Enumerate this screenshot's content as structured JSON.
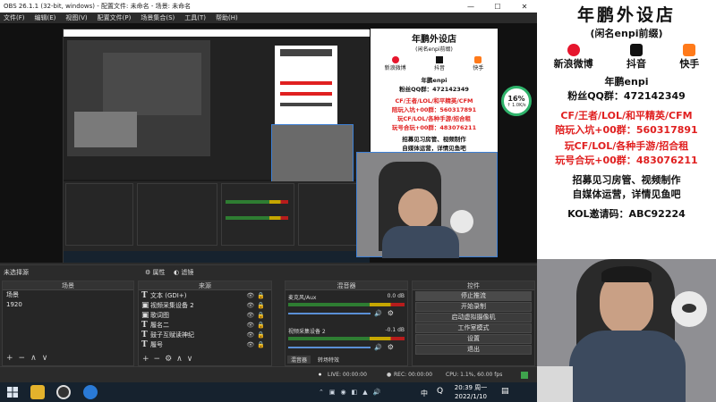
{
  "window": {
    "title": "OBS 26.1.1 (32-bit, windows) - 配置文件: 未命名 - 场景: 未命名"
  },
  "menu": [
    "文件(F)",
    "编辑(E)",
    "视图(V)",
    "配置文件(P)",
    "场景集合(S)",
    "工具(T)",
    "帮助(H)"
  ],
  "preview": {
    "shop_title": "年鹏外设店",
    "shop_subtitle": "(闲名enpi前缀)",
    "socials": [
      {
        "icon": "weibo-icon",
        "label": "新浪微博",
        "color": "#e6162d"
      },
      {
        "icon": "douyin-icon",
        "label": "抖音",
        "color": "#111111"
      },
      {
        "icon": "kuaishou-icon",
        "label": "快手",
        "color": "#ff7a1a"
      }
    ],
    "progress_badge": "16%",
    "progress_sub": "↑ 1.0K/s"
  },
  "filter_bar": {
    "label": "未选择源",
    "props_label": "属性",
    "filters_label": "滤镜"
  },
  "docks": {
    "scenes": {
      "title": "场景",
      "items": [
        "场景",
        "1920"
      ]
    },
    "sources": {
      "title": "来源",
      "items": [
        "文本 (GDI+)",
        "视频采集设备 2",
        "歌词图",
        "履名二",
        "鼓子互赋读神纪",
        "履号"
      ]
    },
    "mixer": {
      "title": "混音器",
      "channels": [
        {
          "name": "麦克风/Aux",
          "db": "0.0 dB"
        },
        {
          "name": "视频采集设备 2",
          "db": "-0.1 dB"
        }
      ],
      "tabs": [
        "混音器",
        "转场特效"
      ]
    },
    "controls": {
      "title": "控件",
      "buttons": [
        "停止推流",
        "开始录制",
        "启动虚拟摄像机",
        "工作室模式",
        "设置",
        "退出"
      ]
    }
  },
  "status": {
    "live": "LIVE: 00:00:00",
    "rec": "REC: 00:00:00",
    "cpu": "CPU: 1.1%, 60.00 fps"
  },
  "taskbar": {
    "time": "20:39 周一",
    "date": "2022/1/10",
    "ime": "中"
  },
  "promo": {
    "title": "年鹏外设店",
    "subtitle": "(闲名enpi前缀)",
    "socials": [
      "新浪微博",
      "抖音",
      "快手"
    ],
    "brand": "年鹏enpi",
    "qq_group": "粉丝QQ群：472142349",
    "line1": "CF/王者/LOL/和平精英/CFM",
    "line2_prefix": "陪玩入坑+00群：",
    "line2_num": "560317891",
    "line3": "玩CF/LOL/各种手游/招合租",
    "line4_prefix": "玩号合玩+00群：",
    "line4_num": "483076211",
    "line5": "招募见习房管、视频制作",
    "line6": "自媒体运营，详情见鱼吧",
    "kol": "KOL邀请码：ABC92224",
    "colors": {
      "red": "#e02020",
      "text": "#111111"
    }
  }
}
